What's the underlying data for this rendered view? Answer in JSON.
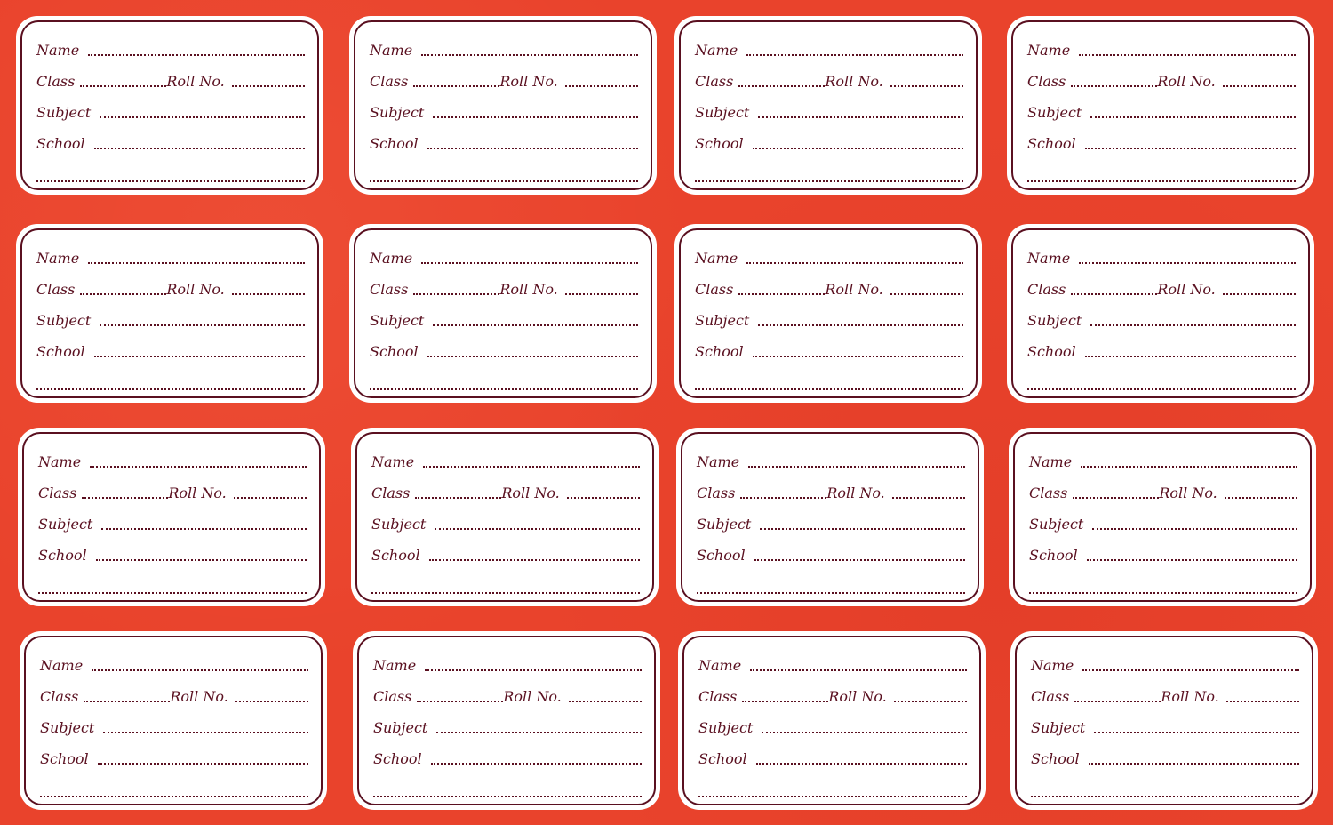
{
  "labels": {
    "name": "Name",
    "class": "Class",
    "roll": "Roll No.",
    "subject": "Subject",
    "school": "School"
  },
  "colors": {
    "background": "#e9432c",
    "label_fill": "#ffffff",
    "ink": "#5a1020"
  },
  "label_count": 16
}
